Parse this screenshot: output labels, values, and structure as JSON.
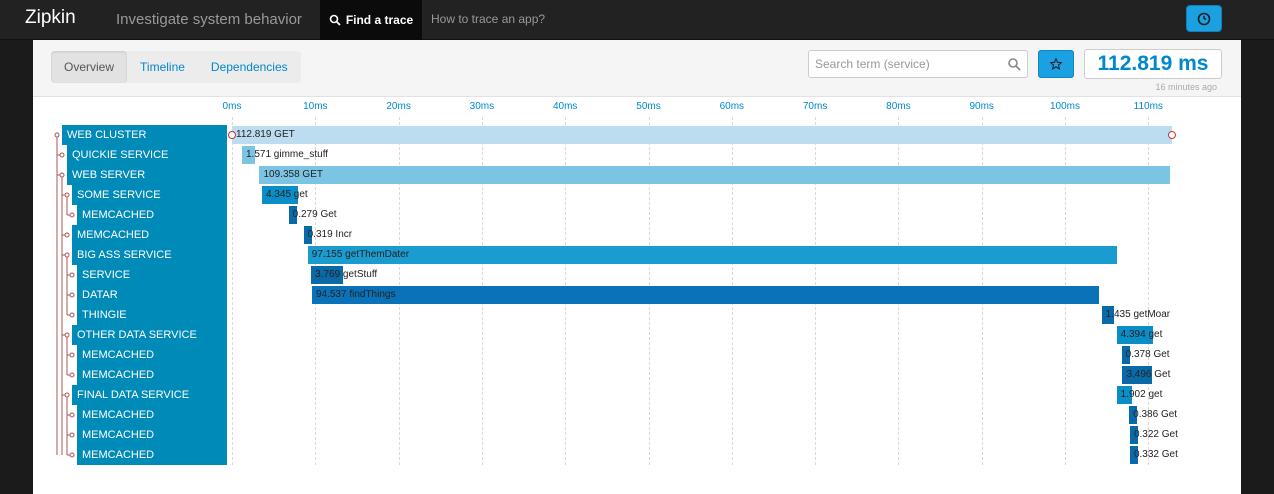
{
  "navbar": {
    "brand": "Zipkin",
    "tagline": "Investigate system behavior",
    "find_trace": "Find a trace",
    "how_to": "How to trace an app?"
  },
  "toolbar": {
    "tabs": [
      "Overview",
      "Timeline",
      "Dependencies"
    ],
    "active_tab": "Overview",
    "search_placeholder": "Search term (service)",
    "duration": "112.819 ms",
    "time_ago": "16 minutes ago"
  },
  "colors": {
    "accent": "#1ba1e2",
    "service_bg": "#008ab8",
    "link": "#0088cc"
  },
  "timeline": {
    "ticks": [
      "0ms",
      "10ms",
      "20ms",
      "30ms",
      "40ms",
      "50ms",
      "60ms",
      "70ms",
      "80ms",
      "90ms",
      "100ms",
      "110ms"
    ],
    "total_ms": 112.819
  },
  "spans": [
    {
      "service": "WEB CLUSTER",
      "depth": 0,
      "start": 0,
      "duration": 112.819,
      "label": "112.819 GET",
      "color": "#bcdcef"
    },
    {
      "service": "QUICKIE SERVICE",
      "depth": 1,
      "start": 1.2,
      "duration": 1.571,
      "label": "1.571 gimme_stuff",
      "color": "#7cc4e4"
    },
    {
      "service": "WEB SERVER",
      "depth": 1,
      "start": 3.3,
      "duration": 109.358,
      "label": "109.358 GET",
      "color": "#7cc4e4"
    },
    {
      "service": "SOME SERVICE",
      "depth": 2,
      "start": 3.6,
      "duration": 4.345,
      "label": "4.345 get",
      "color": "#0a8ec8"
    },
    {
      "service": "MEMCACHED",
      "depth": 3,
      "start": 6.8,
      "duration": 0.979,
      "label": "0.279 Get",
      "color": "#0a6aa8"
    },
    {
      "service": "MEMCACHED",
      "depth": 2,
      "start": 8.6,
      "duration": 0.919,
      "label": "0.319 Incr",
      "color": "#0a6aa8"
    },
    {
      "service": "BIG ASS SERVICE",
      "depth": 2,
      "start": 9.1,
      "duration": 97.155,
      "label": "97.155 getThemDater",
      "color": "#1a9cd0"
    },
    {
      "service": "SERVICE",
      "depth": 3,
      "start": 9.5,
      "duration": 3.769,
      "label": "3.769 getStuff",
      "color": "#0a6aa8"
    },
    {
      "service": "DATAR",
      "depth": 3,
      "start": 9.6,
      "duration": 94.537,
      "label": "94.537 findThings",
      "color": "#0a72b8"
    },
    {
      "service": "THINGIE",
      "depth": 3,
      "start": 104.4,
      "duration": 1.435,
      "label": "1.435 getMoar",
      "color": "#0a6aa8"
    },
    {
      "service": "OTHER DATA SERVICE",
      "depth": 2,
      "start": 106.2,
      "duration": 4.394,
      "label": "4.394 get",
      "color": "#0a8ec8"
    },
    {
      "service": "MEMCACHED",
      "depth": 3,
      "start": 106.8,
      "duration": 0.978,
      "label": "0.378 Get",
      "color": "#0a6aa8"
    },
    {
      "service": "MEMCACHED",
      "depth": 3,
      "start": 106.9,
      "duration": 3.496,
      "label": "3.496 Get",
      "color": "#0a6aa8"
    },
    {
      "service": "FINAL DATA SERVICE",
      "depth": 2,
      "start": 106.2,
      "duration": 1.902,
      "label": "1.902 get",
      "color": "#0a8ec8"
    },
    {
      "service": "MEMCACHED",
      "depth": 3,
      "start": 107.7,
      "duration": 0.986,
      "label": "0.386 Get",
      "color": "#0a6aa8"
    },
    {
      "service": "MEMCACHED",
      "depth": 3,
      "start": 107.8,
      "duration": 0.922,
      "label": "0.322 Get",
      "color": "#0a6aa8"
    },
    {
      "service": "MEMCACHED",
      "depth": 3,
      "start": 107.8,
      "duration": 0.932,
      "label": "0.332 Get",
      "color": "#0a6aa8"
    }
  ]
}
